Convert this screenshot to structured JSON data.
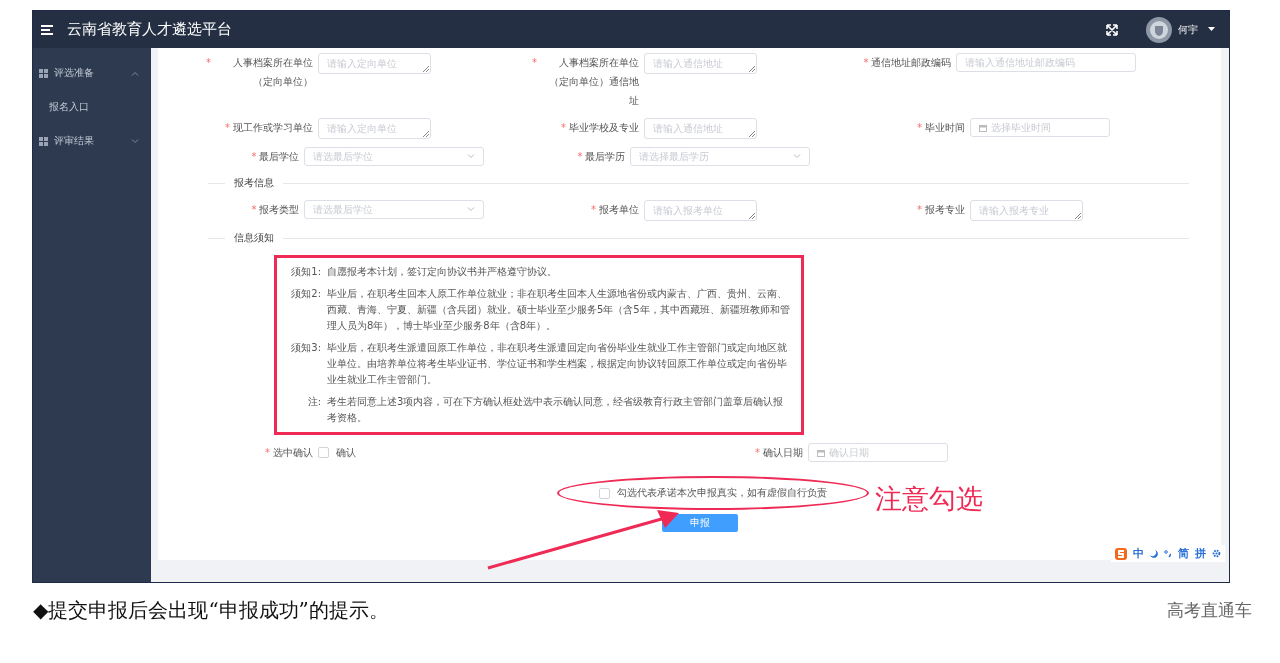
{
  "header": {
    "title": "云南省教育人才遴选平台",
    "user": "何宇"
  },
  "sidebar": {
    "items": [
      {
        "label": "评选准备",
        "expanded": true,
        "children": [
          {
            "label": "报名入口"
          }
        ]
      },
      {
        "label": "评审结果",
        "expanded": false
      }
    ]
  },
  "personal_rows": [
    [
      {
        "label": "人事档案所在单位（定向单位）",
        "mark": "*",
        "kind": "textarea",
        "placeholder": "请输入定向单位"
      },
      {
        "label": "人事档案所在单位（定向单位）通信地址",
        "mark": "*",
        "kind": "textarea",
        "placeholder": "请输入通信地址"
      },
      {
        "label": "通信地址邮政编码",
        "mark": "*",
        "kind": "input",
        "placeholder": "请输入通信地址邮政编码"
      }
    ],
    [
      {
        "label": "现工作或学习单位",
        "mark": "*",
        "kind": "textarea",
        "placeholder": "请输入定向单位"
      },
      {
        "label": "毕业学校及专业",
        "mark": "*",
        "kind": "textarea",
        "placeholder": "请输入通信地址"
      },
      {
        "label": "毕业时间",
        "mark": "*",
        "kind": "date",
        "placeholder": "选择毕业时间"
      }
    ],
    [
      {
        "label": "最后学位",
        "mark": "*",
        "kind": "select",
        "placeholder": "请选最后学位"
      },
      {
        "label": "最后学历",
        "mark": "*",
        "kind": "select",
        "placeholder": "请选择最后学历"
      }
    ]
  ],
  "apply_section": {
    "title": "报考信息",
    "rows": [
      [
        {
          "label": "报考类型",
          "mark": "*",
          "kind": "select",
          "placeholder": "请选最后学位"
        },
        {
          "label": "报考单位",
          "mark": "*",
          "kind": "textarea",
          "placeholder": "请输入报考单位"
        },
        {
          "label": "报考专业",
          "mark": "*",
          "kind": "textarea",
          "placeholder": "请输入报考专业"
        }
      ]
    ]
  },
  "notice_section": {
    "title": "信息须知",
    "notices": [
      {
        "label": "须知1:",
        "text": "自愿报考本计划，签订定向协议书并严格遵守协议。"
      },
      {
        "label": "须知2:",
        "text": "毕业后，在职考生回本人原工作单位就业；非在职考生回本人生源地省份或内蒙古、广西、贵州、云南、西藏、青海、宁夏、新疆（含兵团）就业。硕士毕业至少服务5年（含5年，其中西藏班、新疆班教师和管理人员为8年），博士毕业至少服务8年（含8年）。"
      },
      {
        "label": "须知3:",
        "text": "毕业后，在职考生派遣回原工作单位，非在职考生派遣回定向省份毕业生就业工作主管部门或定向地区就业单位。由培养单位将考生毕业证书、学位证书和学生档案，根据定向协议转回原工作单位或定向省份毕业生就业工作主管部门。"
      },
      {
        "label": "注:",
        "text": "考生若同意上述3项内容，可在下方确认框处选中表示确认同意，经省级教育行政主管部门盖章后确认报考资格。"
      }
    ]
  },
  "confirm": {
    "label": "选中确认",
    "mark": "*",
    "checkbox_label": "确认",
    "checked": false
  },
  "confirm_date": {
    "label": "确认日期",
    "mark": "*",
    "placeholder": "确认日期"
  },
  "pledge": {
    "text": "勾选代表承诺本次申报真实，如有虚假自行负责",
    "checked": false
  },
  "submit_button": "申报",
  "annotation": "注意勾选",
  "ime_bar": {
    "items": [
      "中",
      "简",
      "拼"
    ]
  },
  "caption": "◆提交申报后会出现“申报成功”的提示。",
  "source": "高考直通车"
}
